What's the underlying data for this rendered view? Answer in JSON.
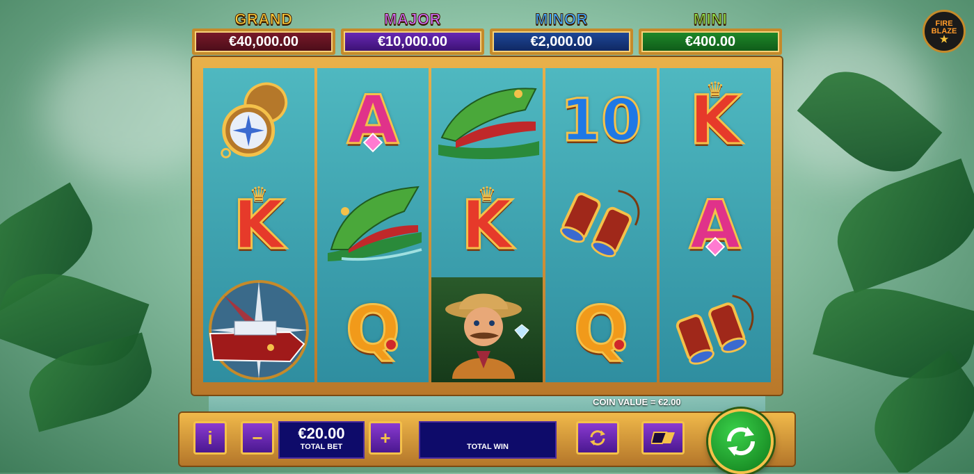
{
  "jackpots": {
    "grand": {
      "label": "GRAND",
      "value": "€40,000.00"
    },
    "major": {
      "label": "MAJOR",
      "value": "€10,000.00"
    },
    "minor": {
      "label": "MINOR",
      "value": "€2,000.00"
    },
    "mini": {
      "label": "MINI",
      "value": "€400.00"
    }
  },
  "logo": {
    "line1": "FIRE",
    "line2": "BLAZE"
  },
  "reels": {
    "r1": {
      "s1": "compass-symbol",
      "s2": "K",
      "s3": "boat-compass-symbol"
    },
    "r2": {
      "s1": "A",
      "s2": "crocodile-symbol",
      "s3": "Q"
    },
    "r3": {
      "s1": "crocodile-symbol",
      "s2": "K",
      "s3": "explorer-symbol"
    },
    "r4": {
      "s1": "10",
      "s2": "binoculars-symbol",
      "s3": "Q"
    },
    "r5": {
      "s1": "K",
      "s2": "A",
      "s3": "binoculars-symbol"
    }
  },
  "coin_value": "COIN VALUE = €2.00",
  "controls": {
    "info_label": "i",
    "minus_label": "−",
    "plus_label": "+",
    "total_bet_value": "€20.00",
    "total_bet_label": "TOTAL BET",
    "total_win_value": "",
    "total_win_label": "TOTAL WIN"
  }
}
